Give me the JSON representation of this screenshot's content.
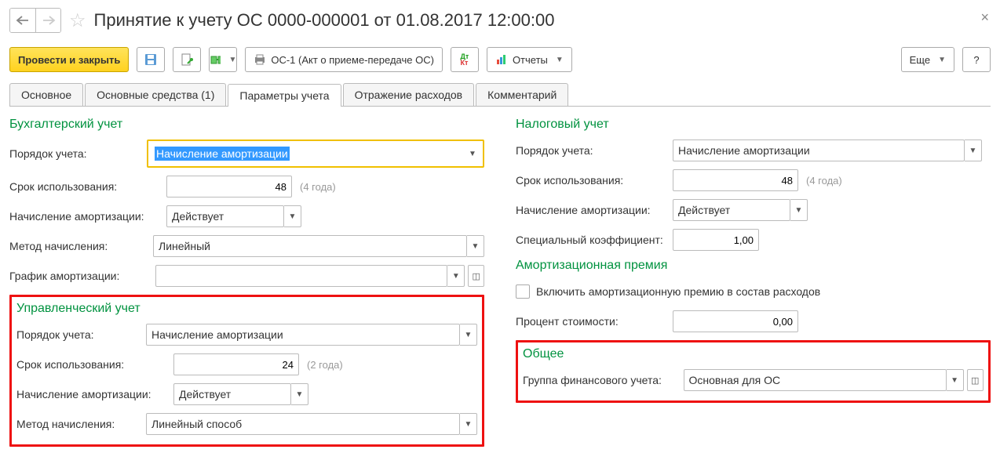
{
  "title": "Принятие к учету ОС 0000-000001 от 01.08.2017 12:00:00",
  "toolbar": {
    "post_close": "Провести и закрыть",
    "os1": "ОС-1 (Акт о приеме-передаче ОС)",
    "reports": "Отчеты",
    "more": "Еще",
    "help": "?"
  },
  "tabs": [
    "Основное",
    "Основные средства (1)",
    "Параметры учета",
    "Отражение расходов",
    "Комментарий"
  ],
  "bu": {
    "title": "Бухгалтерский учет",
    "order_label": "Порядок учета:",
    "order_value": "Начисление амортизации",
    "term_label": "Срок использования:",
    "term_value": "48",
    "term_hint": "(4 года)",
    "depr_label": "Начисление амортизации:",
    "depr_value": "Действует",
    "method_label": "Метод начисления:",
    "method_value": "Линейный",
    "schedule_label": "График амортизации:",
    "schedule_value": ""
  },
  "mu": {
    "title": "Управленческий учет",
    "order_label": "Порядок учета:",
    "order_value": "Начисление амортизации",
    "term_label": "Срок использования:",
    "term_value": "24",
    "term_hint": "(2 года)",
    "depr_label": "Начисление амортизации:",
    "depr_value": "Действует",
    "method_label": "Метод начисления:",
    "method_value": "Линейный способ"
  },
  "nu": {
    "title": "Налоговый учет",
    "order_label": "Порядок учета:",
    "order_value": "Начисление амортизации",
    "term_label": "Срок использования:",
    "term_value": "48",
    "term_hint": "(4 года)",
    "depr_label": "Начисление амортизации:",
    "depr_value": "Действует",
    "coef_label": "Специальный коэффициент:",
    "coef_value": "1,00"
  },
  "bonus": {
    "title": "Амортизационная премия",
    "include_label": "Включить амортизационную премию в состав расходов",
    "percent_label": "Процент стоимости:",
    "percent_value": "0,00"
  },
  "common": {
    "title": "Общее",
    "group_label": "Группа финансового учета:",
    "group_value": "Основная для ОС"
  }
}
